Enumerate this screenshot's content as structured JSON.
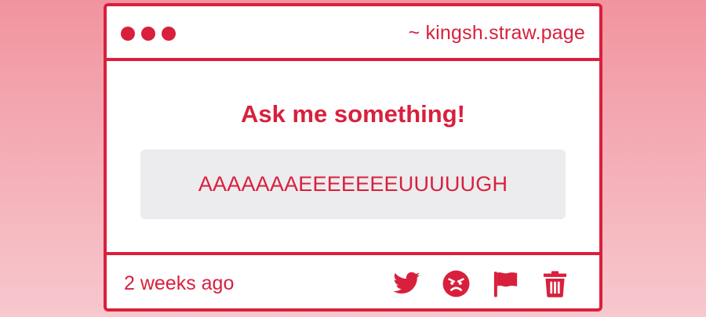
{
  "window": {
    "url": "~ kingsh.straw.page"
  },
  "prompt": {
    "heading": "Ask me something!"
  },
  "question": {
    "text": "AAAAAAAEEEEEEEUUUUUGH"
  },
  "footer": {
    "timestamp": "2 weeks ago",
    "actions": [
      {
        "icon": "twitter-icon"
      },
      {
        "icon": "angry-face-icon"
      },
      {
        "icon": "flag-icon"
      },
      {
        "icon": "trash-icon"
      }
    ]
  },
  "colors": {
    "accent": "#d8203d",
    "question_box": "#ececee",
    "background_top": "#f1949f",
    "background_bottom": "#f7c8ce"
  }
}
